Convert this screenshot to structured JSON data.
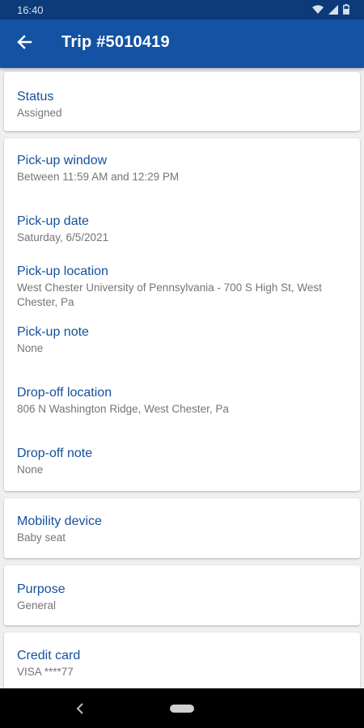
{
  "status_bar": {
    "time": "16:40",
    "icons": [
      "wifi-icon",
      "signal-icon",
      "battery-icon"
    ]
  },
  "app_bar": {
    "title": "Trip #5010419",
    "back_icon": "arrow-back-icon"
  },
  "status_card": {
    "label": "Status",
    "value": "Assigned"
  },
  "trip_card": {
    "pickup_window": {
      "label": "Pick-up window",
      "value": "Between 11:59 AM and 12:29 PM"
    },
    "pickup_date": {
      "label": "Pick-up date",
      "value": "Saturday, 6/5/2021"
    },
    "pickup_location": {
      "label": "Pick-up location",
      "value": "West Chester University of Pennsylvania - 700 S High St, West Chester, Pa"
    },
    "pickup_note": {
      "label": "Pick-up note",
      "value": "None"
    },
    "dropoff_location": {
      "label": "Drop-off location",
      "value": "806 N Washington Ridge, West Chester, Pa"
    },
    "dropoff_note": {
      "label": "Drop-off note",
      "value": "None"
    }
  },
  "mobility_card": {
    "label": "Mobility device",
    "value": "Baby seat"
  },
  "purpose_card": {
    "label": "Purpose",
    "value": "General"
  },
  "credit_card": {
    "label": "Credit card",
    "value": "VISA ****77"
  },
  "colors": {
    "status_bar": "#0d3a78",
    "app_bar": "#1452a3",
    "label": "#14509b",
    "value": "#757575"
  }
}
